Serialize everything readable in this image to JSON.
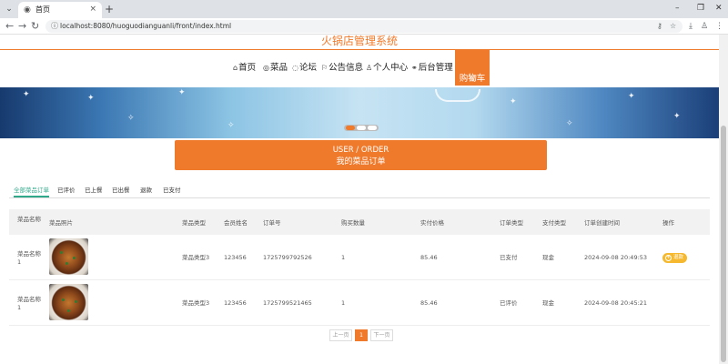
{
  "browser": {
    "tab_title": "首页",
    "new_tab": "+",
    "url": "localhost:8080/huoguodianguanli/front/index.html"
  },
  "site": {
    "title": "火锅店管理系统",
    "menu": [
      {
        "label": "首页",
        "icon": "home-icon",
        "glyph": "⌂"
      },
      {
        "label": "菜品",
        "icon": "dish-icon",
        "glyph": "◎"
      },
      {
        "label": "论坛",
        "icon": "forum-icon",
        "glyph": "◌"
      },
      {
        "label": "公告信息",
        "icon": "flag-icon",
        "glyph": "⚐"
      },
      {
        "label": "个人中心",
        "icon": "user-icon",
        "glyph": "♙"
      },
      {
        "label": "后台管理",
        "icon": "link-icon",
        "glyph": "⚭"
      },
      {
        "label": "购物车",
        "icon": "cart-icon",
        "glyph": "⊞"
      }
    ],
    "active_menu": "购物车"
  },
  "banner": {
    "slides": 3,
    "active_slide": 1
  },
  "order_header": {
    "english": "USER / ORDER",
    "chinese": "我的菜品订单"
  },
  "order_tabs": [
    "全部菜品订单",
    "已评价",
    "已上餐",
    "已出餐",
    "退款",
    "已支付"
  ],
  "active_tab": "全部菜品订单",
  "table": {
    "headers": [
      "菜品名称",
      "菜品照片",
      "菜品类型",
      "会员姓名",
      "订单号",
      "购买数量",
      "实付价格",
      "订单类型",
      "支付类型",
      "订单创建时间",
      "操作"
    ],
    "rows": [
      {
        "name": "菜品名称1",
        "type": "菜品类型3",
        "member": "123456",
        "order_no": "1725799792526",
        "qty": "1",
        "price": "85.46",
        "order_type": "已支付",
        "pay_type": "现金",
        "created": "2024-09-08 20:49:53",
        "action": "退款"
      },
      {
        "name": "菜品名称1",
        "type": "菜品类型3",
        "member": "123456",
        "order_no": "1725799521465",
        "qty": "1",
        "price": "85.46",
        "order_type": "已评价",
        "pay_type": "现金",
        "created": "2024-09-08 20:45:21",
        "action": ""
      }
    ]
  },
  "pager": {
    "prev": "上一页",
    "current": "1",
    "next": "下一页"
  },
  "colors": {
    "accent": "#f07a2b",
    "tab_active": "#2fa98a",
    "refund_button": "#f5b82e"
  }
}
